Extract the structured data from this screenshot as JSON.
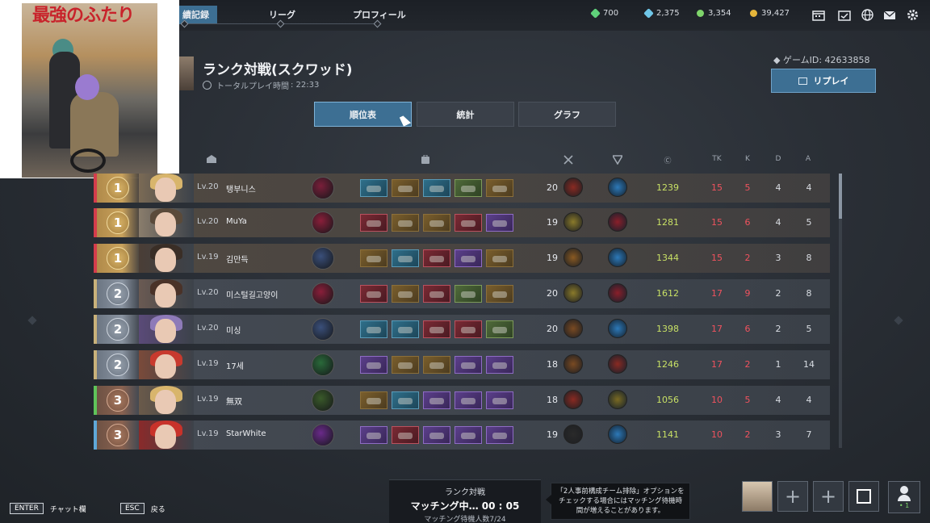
{
  "topbar": {
    "tabs": [
      {
        "label": "績記録",
        "active": true
      },
      {
        "label": "リーグ",
        "active": false
      },
      {
        "label": "プロフィール",
        "active": false
      }
    ],
    "currencies": [
      {
        "icon": "green-crystal-icon",
        "value": "700",
        "color": "#5fd17a"
      },
      {
        "icon": "blue-crystal-icon",
        "value": "2,375",
        "color": "#6fc6e8"
      },
      {
        "icon": "green-coin-icon",
        "value": "3,354",
        "color": "#7fd56b"
      },
      {
        "icon": "gold-coin-icon",
        "value": "39,427",
        "color": "#e5b53a"
      }
    ],
    "system_icons": [
      "calendar-icon",
      "event-calendar-icon",
      "globe-icon",
      "mail-icon",
      "gear-icon"
    ]
  },
  "poster": {
    "title": "最強のふたり"
  },
  "header": {
    "mode_title": "ランク対戦(スクワッド)",
    "playtime_label": "トータルプレイ時間",
    "playtime_value": ": 22:33",
    "game_id": "◆ ゲームID: 42633858",
    "replay_label": "リプレイ"
  },
  "segments": [
    "順位表",
    "統計",
    "グラフ"
  ],
  "columns": {
    "team_icon": "team-icon",
    "loadout_icon": "backpack-icon",
    "weapon_icon": "crossed-swords-icon",
    "tactical_icon": "shield-icon",
    "credit": "Ⓒ",
    "tk": "TK",
    "k": "K",
    "d": "D",
    "a": "A"
  },
  "players": [
    {
      "rank": "1",
      "tier": "r1",
      "stripe": "#d43c4c",
      "level": "Lv.20",
      "name": "탱부니스",
      "char_color": "#7a1f3a",
      "items": [
        "b",
        "y",
        "b",
        "g",
        "y"
      ],
      "lvl": "20",
      "weapon_color": "#8a2a22",
      "tactical_color": "#2d79b8",
      "credit": "1239",
      "tk": "15",
      "k": "5",
      "d": "4",
      "a": "4",
      "hair": "#d8b56c",
      "bg": "#7a6a55"
    },
    {
      "rank": "1",
      "tier": "r1",
      "stripe": "#d43c4c",
      "level": "Lv.20",
      "name": "MuYa",
      "char_color": "#8a1f3a",
      "items": [
        "r",
        "y",
        "y",
        "r",
        "p"
      ],
      "lvl": "19",
      "weapon_color": "#8a7a2a",
      "tactical_color": "#8a1f2a",
      "credit": "1281",
      "tk": "15",
      "k": "6",
      "d": "4",
      "a": "5",
      "hair": "#5a4a3a",
      "bg": "#8a7d6c"
    },
    {
      "rank": "1",
      "tier": "r1",
      "stripe": "#d43c4c",
      "level": "Lv.19",
      "name": "김만득",
      "char_color": "#3a4f7a",
      "items": [
        "y",
        "b",
        "r",
        "p",
        "y"
      ],
      "lvl": "19",
      "weapon_color": "#8a5a22",
      "tactical_color": "#2d79b8",
      "credit": "1344",
      "tk": "15",
      "k": "2",
      "d": "3",
      "a": "8",
      "hair": "#3a2e26",
      "bg": "#4a3e36"
    },
    {
      "rank": "2",
      "tier": "r2",
      "stripe": "#c9b17a",
      "level": "Lv.20",
      "name": "미스털길고양이",
      "char_color": "#8a1f3a",
      "items": [
        "r",
        "y",
        "r",
        "g",
        "y"
      ],
      "lvl": "20",
      "weapon_color": "#8a7a2a",
      "tactical_color": "#8a1f2a",
      "credit": "1612",
      "tk": "17",
      "k": "9",
      "d": "2",
      "a": "8",
      "hair": "#4a3228",
      "bg": "#6a5a52"
    },
    {
      "rank": "2",
      "tier": "r2",
      "stripe": "#c9b17a",
      "level": "Lv.20",
      "name": "미싱",
      "char_color": "#3a4f7a",
      "items": [
        "b",
        "b",
        "r",
        "r",
        "g"
      ],
      "lvl": "20",
      "weapon_color": "#7a4a22",
      "tactical_color": "#2d79b8",
      "credit": "1398",
      "tk": "17",
      "k": "6",
      "d": "2",
      "a": "5",
      "hair": "#8e7ab8",
      "bg": "#5a4a78"
    },
    {
      "rank": "2",
      "tier": "r2",
      "stripe": "#c9b17a",
      "level": "Lv.19",
      "name": "17세",
      "char_color": "#2a6a3a",
      "items": [
        "p",
        "y",
        "y",
        "p",
        "p"
      ],
      "lvl": "18",
      "weapon_color": "#7a4a22",
      "tactical_color": "#8a2a22",
      "credit": "1246",
      "tk": "17",
      "k": "2",
      "d": "1",
      "a": "14",
      "hair": "#c83a2e",
      "bg": "#7a4a3a"
    },
    {
      "rank": "3",
      "tier": "r3",
      "stripe": "#5fc35a",
      "level": "Lv.19",
      "name": "無双",
      "char_color": "#3a5a2a",
      "items": [
        "y",
        "b",
        "p",
        "p",
        "p"
      ],
      "lvl": "18",
      "weapon_color": "#8a2a22",
      "tactical_color": "#7a6a22",
      "credit": "1056",
      "tk": "10",
      "k": "5",
      "d": "4",
      "a": "4",
      "hair": "#d8b56c",
      "bg": "#6a5a4a"
    },
    {
      "rank": "3",
      "tier": "r3",
      "stripe": "#5fa8d8",
      "level": "Lv.19",
      "name": "StarWhite",
      "char_color": "#6a2a8a",
      "items": [
        "p",
        "r",
        "p",
        "p",
        "p"
      ],
      "lvl": "19",
      "weapon_color": "#2a2a2a",
      "tactical_color": "#2d79b8",
      "credit": "1141",
      "tk": "10",
      "k": "2",
      "d": "3",
      "a": "7",
      "hair": "#c8322a",
      "bg": "#8a2a2a"
    }
  ],
  "footer": {
    "enter_key": "ENTER",
    "enter_label": "チャット欄",
    "esc_key": "ESC",
    "esc_label": "戻る",
    "matching_mode": "ランク対戦",
    "matching_status": "マッチング中… 00 : 05",
    "matching_waiting": "マッチング待機人数7/24",
    "notice": "「2人事前構成チーム排除」オプションをチェックする場合にはマッチング待機時間が増えることがあります。",
    "party_plus": "+",
    "friends_count": "• 1"
  }
}
